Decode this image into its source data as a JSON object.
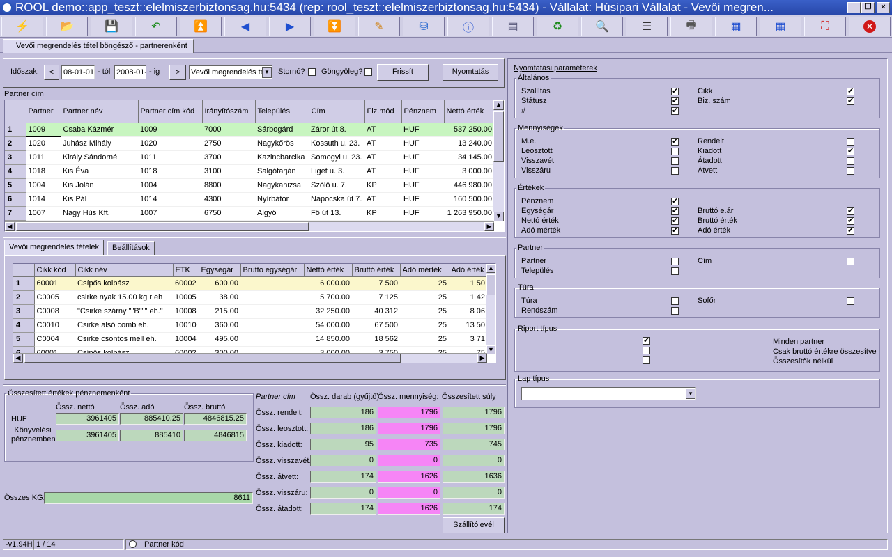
{
  "window": {
    "title": "ROOL demo::app_teszt::elelmiszerbiztonsag.hu:5434 (rep: rool_teszt::elelmiszerbiztonsag.hu:5434) - Vállalat: Húsipari Vállalat - Vevői megren..."
  },
  "toolbar": {
    "icons": [
      "lightning-icon",
      "open-folder-icon",
      "save-disk-icon",
      "refresh-arrow-icon",
      "first-record-icon",
      "previous-icon",
      "next-icon",
      "last-record-icon",
      "edit-pencil-icon",
      "database-icon",
      "info-icon",
      "window-icon",
      "reload-icon",
      "search-icon",
      "layout-icon",
      "print-preview-icon",
      "grid-next-icon",
      "grid-icon",
      "fullscreen-icon",
      "close-icon"
    ]
  },
  "tab": {
    "label": "Vevői megrendelés tétel böngésző - partnerenként"
  },
  "filter": {
    "period_label": "Időszak:",
    "date_from": "08-01-01",
    "from_label": "- tól",
    "date_to": "2008-01-",
    "to_label": "- ig",
    "type_value": "Vevői megrendelés té",
    "storno_label": "Stornó?",
    "gongyoleg_label": "Göngyöleg?",
    "refresh_label": "Frissít",
    "print_label": "Nyomtatás"
  },
  "partner_grid": {
    "caption": "Partner cím",
    "columns": [
      "Partner",
      "Partner név",
      "Partner cím kód",
      "Irányítószám",
      "Település",
      "Cím",
      "Fiz.mód",
      "Pénznem",
      "Nettó érték"
    ],
    "rows": [
      [
        "1",
        "1009",
        "Csaba Kázmér",
        "1009",
        "7000",
        "Sárbogárd",
        "Záror út 8.",
        "AT",
        "HUF",
        "537 250.00"
      ],
      [
        "2",
        "1020",
        "Juhász Mihály",
        "1020",
        "2750",
        "Nagykőrös",
        "Kossuth u. 23.",
        "AT",
        "HUF",
        "13 240.00"
      ],
      [
        "3",
        "1011",
        "Király Sándorné",
        "1011",
        "3700",
        "Kazincbarcika",
        "Somogyi u. 23.",
        "AT",
        "HUF",
        "34 145.00"
      ],
      [
        "4",
        "1018",
        "Kis Éva",
        "1018",
        "3100",
        "Salgótarján",
        "Liget u. 3.",
        "AT",
        "HUF",
        "3 000.00"
      ],
      [
        "5",
        "1004",
        "Kis Jolán",
        "1004",
        "8800",
        "Nagykanizsa",
        "Szőlő u. 7.",
        "KP",
        "HUF",
        "446 980.00"
      ],
      [
        "6",
        "1014",
        "Kis Pál",
        "1014",
        "4300",
        "Nyírbátor",
        "Napocska út 7.",
        "AT",
        "HUF",
        "160 500.00"
      ],
      [
        "7",
        "1007",
        "Nagy Hús Kft.",
        "1007",
        "6750",
        "Algyő",
        "Fő út 13.",
        "KP",
        "HUF",
        "1 263 950.00"
      ]
    ]
  },
  "subtabs": {
    "items": [
      "Vevői megrendelés tételek",
      "Beállítások"
    ]
  },
  "item_grid": {
    "columns": [
      "Cikk kód",
      "Cikk név",
      "ETK",
      "Egységár",
      "Bruttó egységár",
      "Nettó érték",
      "Bruttó érték",
      "Adó mérték",
      "Adó érték"
    ],
    "rows": [
      [
        "1",
        "60001",
        "Csípős kolbász",
        "60002",
        "600.00",
        "",
        "6 000.00",
        "7 500",
        "25",
        "1 50"
      ],
      [
        "2",
        "C0005",
        "csirke nyak 15.00 kg r eh",
        "10005",
        "38.00",
        "",
        "5 700.00",
        "7 125",
        "25",
        "1 42"
      ],
      [
        "3",
        "C0008",
        "\"Csirke szárny \"\"B\"\"\" eh.\"",
        "10008",
        "215.00",
        "",
        "32 250.00",
        "40 312",
        "25",
        "8 06"
      ],
      [
        "4",
        "C0010",
        "Csirke alsó comb eh.",
        "10010",
        "360.00",
        "",
        "54 000.00",
        "67 500",
        "25",
        "13 50"
      ],
      [
        "5",
        "C0004",
        "Csirke csontos mell eh.",
        "10004",
        "495.00",
        "",
        "14 850.00",
        "18 562",
        "25",
        "3 71"
      ],
      [
        "6",
        "60001",
        "Csípős kolbász",
        "60002",
        "300.00",
        "",
        "3 000.00",
        "3 750",
        "25",
        "75"
      ]
    ]
  },
  "summary": {
    "legend": "Összesített értékek pénznemenként",
    "headers": [
      "Össz. nettó",
      "Össz. adó",
      "Össz. bruttó"
    ],
    "rows": [
      {
        "label": "HUF",
        "values": [
          "3961405",
          "885410.25",
          "4846815.25"
        ]
      },
      {
        "label": "Könyvelési pénznemben",
        "values": [
          "3961405",
          "885410",
          "4846815"
        ]
      }
    ],
    "kg_label": "Összes KG:",
    "kg_value": "8611"
  },
  "qty": {
    "header_label": "Partner cím",
    "headers": [
      "Össz. darab (gyűjtő):",
      "Össz. mennyiség:",
      "Összesített súly"
    ],
    "rows": [
      {
        "label": "Össz. rendelt:",
        "values": [
          "186",
          "1796",
          "1796"
        ]
      },
      {
        "label": "Össz. leosztott:",
        "values": [
          "186",
          "1796",
          "1796"
        ]
      },
      {
        "label": "Össz. kiadott:",
        "values": [
          "95",
          "735",
          "745"
        ]
      },
      {
        "label": "Össz. visszavét.:",
        "values": [
          "0",
          "0",
          "0"
        ]
      },
      {
        "label": "Össz. átvett:",
        "values": [
          "174",
          "1626",
          "1636"
        ]
      },
      {
        "label": "Össz. visszáru:",
        "values": [
          "0",
          "0",
          "0"
        ]
      },
      {
        "label": "Össz. átadott:",
        "values": [
          "174",
          "1626",
          "174"
        ]
      }
    ],
    "delivery_button": "Szállítólevél"
  },
  "print_params": {
    "title": "Nyomtatási paraméterek",
    "groups": [
      {
        "legend": "Általános",
        "left": [
          {
            "label": "Szállítás",
            "on": true
          },
          {
            "label": "Státusz",
            "on": true
          },
          {
            "label": "#",
            "on": true
          }
        ],
        "right": [
          {
            "label": "Cikk",
            "on": true
          },
          {
            "label": "Biz. szám",
            "on": true
          }
        ]
      },
      {
        "legend": "Mennyiségek",
        "left": [
          {
            "label": "M.e.",
            "on": true
          },
          {
            "label": "Leosztott",
            "on": false
          },
          {
            "label": "Visszavét",
            "on": false
          },
          {
            "label": "Visszáru",
            "on": false
          }
        ],
        "right": [
          {
            "label": "Rendelt",
            "on": false
          },
          {
            "label": "Kiadott",
            "on": true
          },
          {
            "label": "Átadott",
            "on": false
          },
          {
            "label": "Átvett",
            "on": false
          }
        ]
      },
      {
        "legend": "Értékek",
        "left": [
          {
            "label": "Pénznem",
            "on": true
          },
          {
            "label": "Egységár",
            "on": true
          },
          {
            "label": "Nettó érték",
            "on": true
          },
          {
            "label": "Adó mérték",
            "on": true
          }
        ],
        "right": [
          {
            "label": "",
            "on": null
          },
          {
            "label": "Bruttó e.ár",
            "on": true
          },
          {
            "label": "Bruttó érték",
            "on": true
          },
          {
            "label": "Adó érték",
            "on": true
          }
        ]
      },
      {
        "legend": "Partner",
        "left": [
          {
            "label": "Partner",
            "on": false
          },
          {
            "label": "Település",
            "on": false
          }
        ],
        "right": [
          {
            "label": "Cím",
            "on": false
          }
        ]
      },
      {
        "legend": "Túra",
        "left": [
          {
            "label": "Túra",
            "on": false
          },
          {
            "label": "Rendszám",
            "on": false
          }
        ],
        "right": [
          {
            "label": "Sofőr",
            "on": false
          }
        ]
      }
    ],
    "report_legend": "Riport típus",
    "report_options": [
      {
        "label": "Minden partner",
        "on": true
      },
      {
        "label": "Csak bruttó értékre összesítve",
        "on": false
      },
      {
        "label": "Összesítők nélkül",
        "on": false
      }
    ],
    "page_legend": "Lap típus",
    "page_value": ""
  },
  "status": {
    "version": "-v1.94H",
    "position": "1 / 14",
    "partner_code": "Partner kód"
  }
}
